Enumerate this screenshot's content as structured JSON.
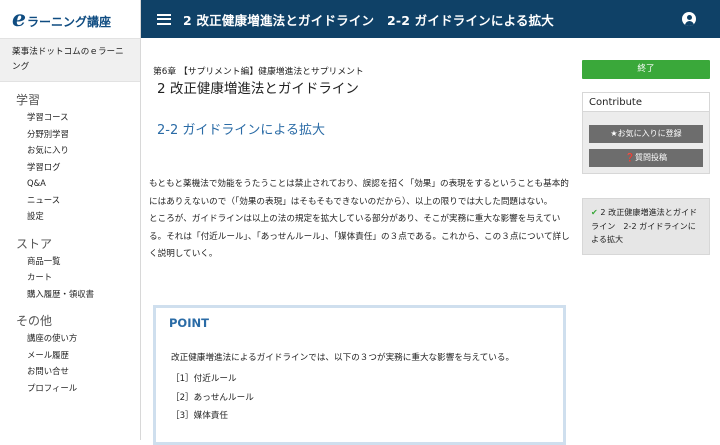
{
  "brand": {
    "logo_e": "e",
    "logo_text": "ラーニング講座"
  },
  "site_title": "薬事法ドットコムのｅラーニング",
  "sidebar": {
    "sections": [
      {
        "heading": "学習",
        "items": [
          "学習コース",
          "分野別学習",
          "お気に入り",
          "学習ログ",
          "Q&A",
          "ニュース",
          "設定"
        ]
      },
      {
        "heading": "ストア",
        "items": [
          "商品一覧",
          "カート",
          "購入履歴・領収書"
        ]
      },
      {
        "heading": "その他",
        "items": [
          "講座の使い方",
          "メール履歴",
          "お問い合せ",
          "プロフィール"
        ]
      }
    ]
  },
  "header": {
    "title": "2 改正健康増進法とガイドライン　2-2 ガイドラインによる拡大"
  },
  "main": {
    "chapter": "第6章 【サプリメント編】健康増進法とサプリメント",
    "title": "2 改正健康増進法とガイドライン",
    "section_title": "2-2 ガイドラインによる拡大",
    "paragraphs": [
      "もともと薬機法で効能をうたうことは禁止されており、誤認を招く「効果」の表現をするということも基本的にはありえないので（「効果の表現」はそもそもできないのだから）、以上の限りでは大した問題はない。",
      "ところが、ガイドラインは以上の法の規定を拡大している部分があり、そこが実務に重大な影響を与えている。それは「付近ルール」、「あっせんルール」、「媒体責任」の３点である。これから、この３点について詳しく説明していく。"
    ],
    "point": {
      "title": "POINT",
      "lead": "改正健康増進法によるガイドラインでは、以下の３つが実務に重大な影響を与えている。",
      "items": [
        "［1］付近ルール",
        "［2］あっせんルール",
        "［3］媒体責任"
      ]
    }
  },
  "right": {
    "finish_label": "終了",
    "contribute_title": "Contribute",
    "favorite_label": "★お気に入りに登録",
    "question_label": "❓質問投稿",
    "toc_check": "✔",
    "toc_text": "2 改正健康増進法とガイドライン　2-2 ガイドラインによる拡大"
  },
  "colors": {
    "header_bg": "#0f4167",
    "accent_blue": "#2a6ba6",
    "finish_green": "#3aa83a",
    "button_gray": "#6d6d6d"
  }
}
